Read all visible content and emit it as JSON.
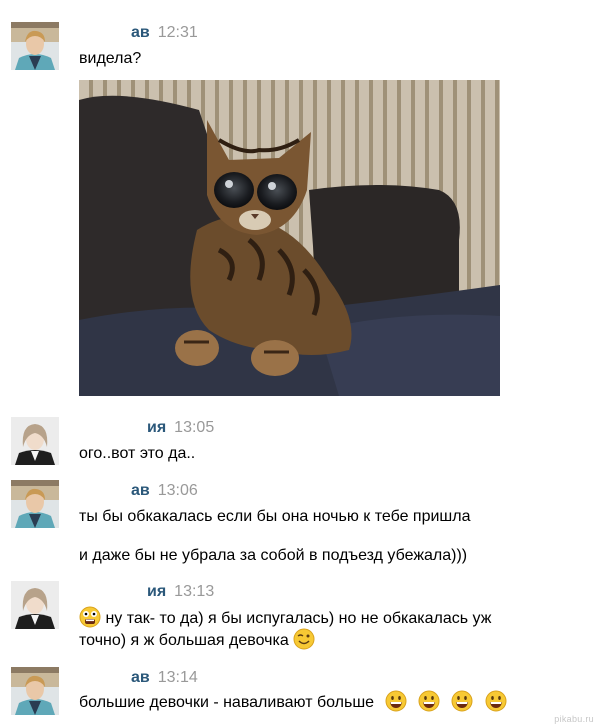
{
  "messages": [
    {
      "sender": "ав",
      "time": "12:31",
      "lines": [
        "видела?"
      ]
    },
    {
      "sender": "ия",
      "time": "13:05",
      "lines": [
        "ого..вот это да.."
      ]
    },
    {
      "sender": "ав",
      "time": "13:06",
      "lines": [
        "ты бы обкакалась если бы она ночью к тебе пришла",
        "и даже бы не убрала за собой в подъезд убежала)))"
      ]
    },
    {
      "sender": "ия",
      "time": "13:13",
      "lines": [
        "ну так- то да) я бы испугалась) но не обкакалась уж",
        "точно) я ж большая девочка"
      ]
    },
    {
      "sender": "ав",
      "time": "13:14",
      "lines": [
        "большие девочки - наваливают больше"
      ]
    }
  ],
  "watermark": "pikabu.ru",
  "icons": {
    "emoji_scared": "scared-face-icon",
    "emoji_wink": "wink-face-icon",
    "emoji_grin": "grinning-face-icon"
  },
  "colors": {
    "sender_name": "#2b587a",
    "timestamp": "#999999",
    "background": "#ffffff"
  }
}
